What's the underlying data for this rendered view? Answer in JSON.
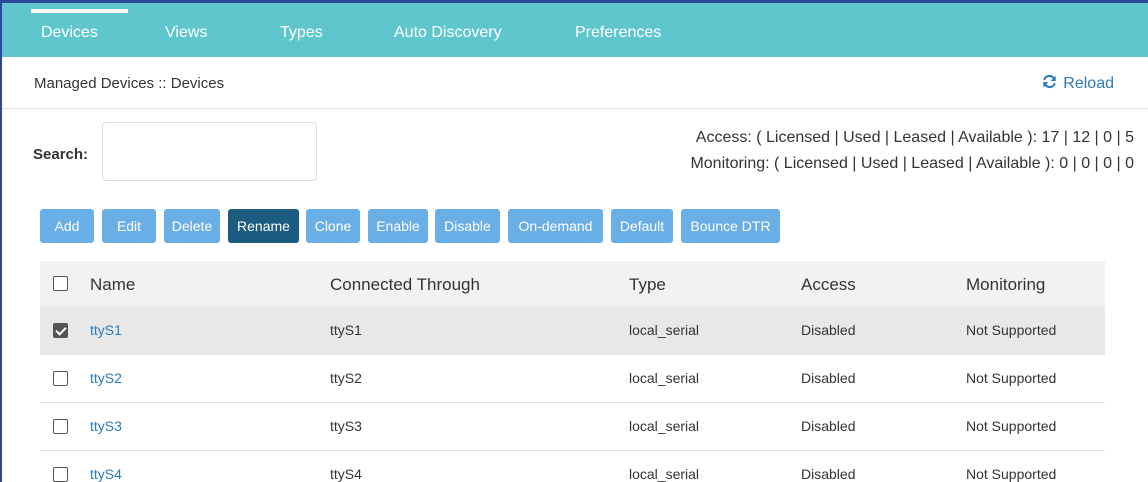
{
  "nav": {
    "tabs": [
      {
        "label": "Devices",
        "active": true
      },
      {
        "label": "Views",
        "active": false
      },
      {
        "label": "Types",
        "active": false
      },
      {
        "label": "Auto Discovery",
        "active": false
      },
      {
        "label": "Preferences",
        "active": false
      }
    ]
  },
  "breadcrumb": "Managed Devices :: Devices",
  "reload": {
    "label": "Reload",
    "icon": "refresh-icon"
  },
  "search": {
    "label": "Search:",
    "value": "",
    "placeholder": ""
  },
  "license": {
    "access": "Access: ( Licensed | Used | Leased | Available ): 17 | 12 | 0 | 5",
    "monitoring": "Monitoring: ( Licensed | Used | Leased | Available ): 0 | 0 | 0 | 0"
  },
  "toolbar": {
    "buttons": [
      {
        "label": "Add"
      },
      {
        "label": "Edit"
      },
      {
        "label": "Delete"
      },
      {
        "label": "Rename",
        "active": true
      },
      {
        "label": "Clone"
      },
      {
        "label": "Enable"
      },
      {
        "label": "Disable"
      },
      {
        "label": "On-demand"
      },
      {
        "label": "Default"
      },
      {
        "label": "Bounce DTR"
      }
    ]
  },
  "table": {
    "columns": [
      "Name",
      "Connected Through",
      "Type",
      "Access",
      "Monitoring"
    ],
    "rows": [
      {
        "selected": true,
        "name": "ttyS1",
        "connected": "ttyS1",
        "type": "local_serial",
        "access": "Disabled",
        "monitoring": "Not Supported"
      },
      {
        "selected": false,
        "name": "ttyS2",
        "connected": "ttyS2",
        "type": "local_serial",
        "access": "Disabled",
        "monitoring": "Not Supported"
      },
      {
        "selected": false,
        "name": "ttyS3",
        "connected": "ttyS3",
        "type": "local_serial",
        "access": "Disabled",
        "monitoring": "Not Supported"
      },
      {
        "selected": false,
        "name": "ttyS4",
        "connected": "ttyS4",
        "type": "local_serial",
        "access": "Disabled",
        "monitoring": "Not Supported"
      }
    ]
  },
  "colors": {
    "nav_bg": "#5ec6cc",
    "button": "#6aaee6",
    "button_active": "#1c5c80",
    "link": "#2a7ab8"
  }
}
